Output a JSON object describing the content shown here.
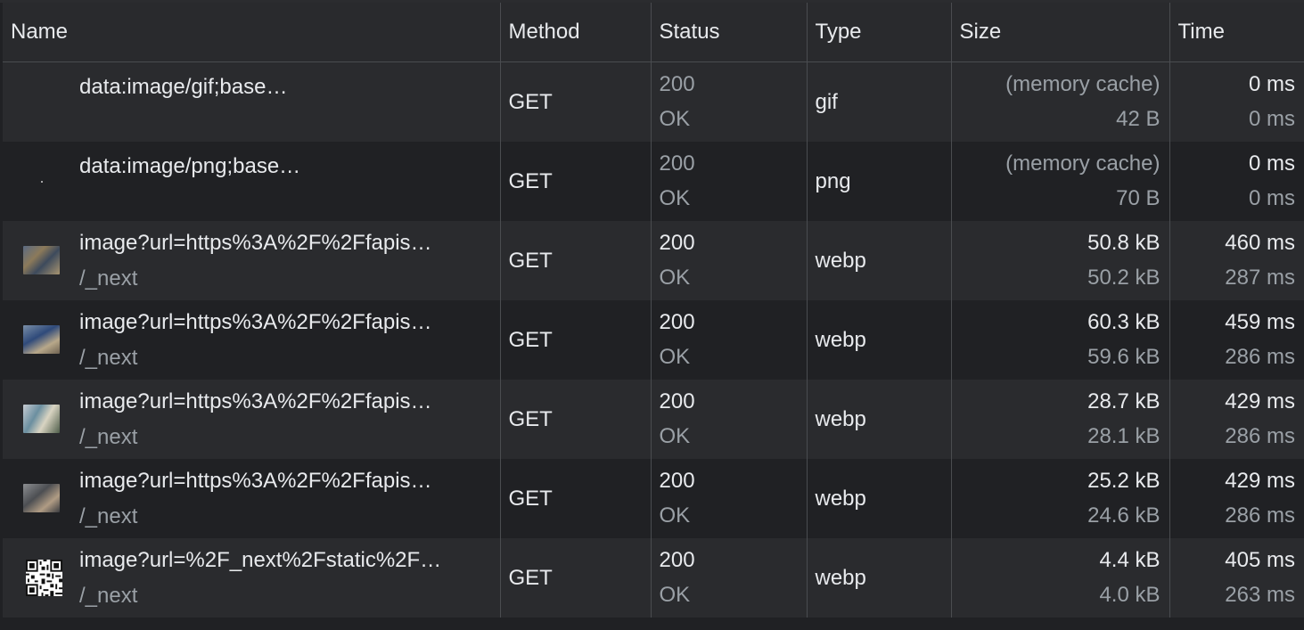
{
  "columns": {
    "name": "Name",
    "method": "Method",
    "status": "Status",
    "type": "Type",
    "size": "Size",
    "time": "Time"
  },
  "rows": [
    {
      "name": "data:image/gif;base…",
      "initiator": "",
      "method": "GET",
      "status_code": "200",
      "status_text": "OK",
      "type": "gif",
      "size_transferred": "(memory cache)",
      "size_resource": "42 B",
      "time_total": "0 ms",
      "time_latency": "0 ms",
      "thumb": "blank"
    },
    {
      "name": "data:image/png;base…",
      "initiator": "",
      "method": "GET",
      "status_code": "200",
      "status_text": "OK",
      "type": "png",
      "size_transferred": "(memory cache)",
      "size_resource": "70 B",
      "time_total": "0 ms",
      "time_latency": "0 ms",
      "thumb": "dot"
    },
    {
      "name": "image?url=https%3A%2F%2Ffapis…",
      "initiator": "/_next",
      "method": "GET",
      "status_code": "200",
      "status_text": "OK",
      "type": "webp",
      "size_transferred": "50.8 kB",
      "size_resource": "50.2 kB",
      "time_total": "460 ms",
      "time_latency": "287 ms",
      "thumb": "photo"
    },
    {
      "name": "image?url=https%3A%2F%2Ffapis…",
      "initiator": "/_next",
      "method": "GET",
      "status_code": "200",
      "status_text": "OK",
      "type": "webp",
      "size_transferred": "60.3 kB",
      "size_resource": "59.6 kB",
      "time_total": "459 ms",
      "time_latency": "286 ms",
      "thumb": "photo"
    },
    {
      "name": "image?url=https%3A%2F%2Ffapis…",
      "initiator": "/_next",
      "method": "GET",
      "status_code": "200",
      "status_text": "OK",
      "type": "webp",
      "size_transferred": "28.7 kB",
      "size_resource": "28.1 kB",
      "time_total": "429 ms",
      "time_latency": "286 ms",
      "thumb": "photo"
    },
    {
      "name": "image?url=https%3A%2F%2Ffapis…",
      "initiator": "/_next",
      "method": "GET",
      "status_code": "200",
      "status_text": "OK",
      "type": "webp",
      "size_transferred": "25.2 kB",
      "size_resource": "24.6 kB",
      "time_total": "429 ms",
      "time_latency": "286 ms",
      "thumb": "photo"
    },
    {
      "name": "image?url=%2F_next%2Fstatic%2F…",
      "initiator": "/_next",
      "method": "GET",
      "status_code": "200",
      "status_text": "OK",
      "type": "webp",
      "size_transferred": "4.4 kB",
      "size_resource": "4.0 kB",
      "time_total": "405 ms",
      "time_latency": "263 ms",
      "thumb": "qr-code"
    }
  ],
  "colors": {
    "background": "#202124",
    "row_alt": "#2a2b2e",
    "header": "#292a2d",
    "text_primary": "#e8eaed",
    "text_dim": "#9aa0a6",
    "grid_line": "#4a4c50"
  }
}
